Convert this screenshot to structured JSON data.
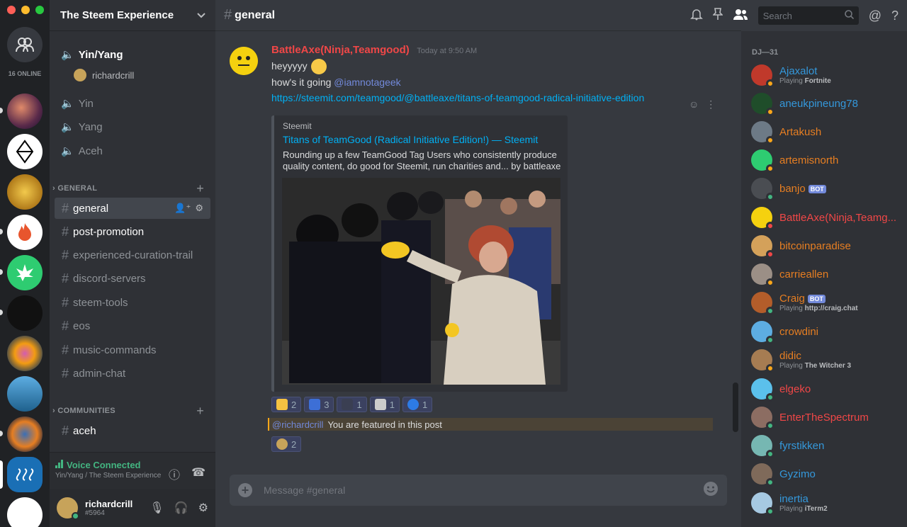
{
  "guild": {
    "name": "The Steem Experience",
    "online_count": "16 ONLINE"
  },
  "voice_channels": [
    {
      "label": "Yin/Yang",
      "users": [
        "richardcrill"
      ]
    },
    {
      "label": "Yin"
    },
    {
      "label": "Yang"
    },
    {
      "label": "Aceh"
    }
  ],
  "categories": {
    "general": "GENERAL",
    "communities": "COMMUNITIES"
  },
  "text_channels": [
    "general",
    "post-promotion",
    "experienced-curation-trail",
    "discord-servers",
    "steem-tools",
    "eos",
    "music-commands",
    "admin-chat"
  ],
  "community_channels": [
    "aceh"
  ],
  "voice_status": {
    "title": "Voice Connected",
    "subtitle": "Yin/Yang / The Steem Experience"
  },
  "user": {
    "name": "richardcrill",
    "tag": "#5964"
  },
  "channel_header": {
    "name": "general",
    "search_placeholder": "Search"
  },
  "message": {
    "author": "BattleAxe(Ninja,Teamgood)",
    "timestamp": "Today at 9:50 AM",
    "line1": "heyyyyy",
    "line2_prefix": "how's it going",
    "line2_mention": "@iamnotageek",
    "link": "https://steemit.com/teamgood/@battleaxe/titans-of-teamgood-radical-initiative-edition",
    "embed": {
      "provider": "Steemit",
      "title": "Titans of TeamGood (Radical Initiative Edition!) — Steemit",
      "description": "Rounding up a few TeamGood Tag Users who consistently produce quality content, do good for Steemit, run charities and... by battleaxe"
    },
    "reactions": [
      {
        "count": "2",
        "color": "#f5c242"
      },
      {
        "count": "3",
        "color": "#3d6fd6"
      },
      {
        "count": "1",
        "color": "#3a3f52"
      },
      {
        "count": "1",
        "color": "#cccccc"
      },
      {
        "count": "1",
        "color": "#2d7be5"
      }
    ],
    "featured": {
      "mention": "@richardcrill",
      "text": "You are featured in this post"
    },
    "reaction2": {
      "count": "2"
    }
  },
  "composer": {
    "placeholder": "Message #general"
  },
  "members": {
    "heading": "DJ—31",
    "list": [
      {
        "name": "Ajaxalot",
        "color": "#3498db",
        "status": "#faa61a",
        "sub_prefix": "Playing",
        "sub_bold": "Fortnite",
        "avatar": "#c0392b"
      },
      {
        "name": "aneukpineung78",
        "color": "#3498db",
        "status": "#faa61a",
        "avatar": "#1f4d2a"
      },
      {
        "name": "Artakush",
        "color": "#e67e22",
        "status": "#faa61a",
        "avatar": "#6d7a86"
      },
      {
        "name": "artemisnorth",
        "color": "#e67e22",
        "status": "#faa61a",
        "avatar": "#2ecc71"
      },
      {
        "name": "banjo",
        "color": "#e67e22",
        "status": "#43b581",
        "bot": "BOT",
        "avatar": "#4a4d52"
      },
      {
        "name": "BattleAxe(Ninja,Teamg...",
        "color": "#f04747",
        "status": "#f04747",
        "avatar": "#f5d10f"
      },
      {
        "name": "bitcoinparadise",
        "color": "#e67e22",
        "status": "#f04747",
        "avatar": "#d4a15a"
      },
      {
        "name": "carrieallen",
        "color": "#e67e22",
        "status": "#faa61a",
        "avatar": "#9b8f86"
      },
      {
        "name": "Craig",
        "color": "#e67e22",
        "status": "#43b581",
        "bot": "BOT",
        "sub_prefix": "Playing",
        "sub_bold": "http://craig.chat",
        "avatar": "#b35d2a"
      },
      {
        "name": "crowdini",
        "color": "#e67e22",
        "status": "#43b581",
        "avatar": "#5dade2"
      },
      {
        "name": "didic",
        "color": "#e67e22",
        "status": "#faa61a",
        "sub_prefix": "Playing",
        "sub_bold": "The Witcher 3",
        "avatar": "#a67c52"
      },
      {
        "name": "elgeko",
        "color": "#f04747",
        "status": "#43b581",
        "avatar": "#5bc0eb"
      },
      {
        "name": "EnterTheSpectrum",
        "color": "#f04747",
        "status": "#43b581",
        "avatar": "#8c6d62"
      },
      {
        "name": "fyrstikken",
        "color": "#3498db",
        "status": "#43b581",
        "avatar": "#76b7b2"
      },
      {
        "name": "Gyzimo",
        "color": "#3498db",
        "status": "#43b581",
        "avatar": "#7f6a5a"
      },
      {
        "name": "inertia",
        "color": "#3498db",
        "status": "#43b581",
        "sub_prefix": "Playing",
        "sub_bold": "iTerm2",
        "avatar": "#a6c9e2"
      }
    ]
  }
}
